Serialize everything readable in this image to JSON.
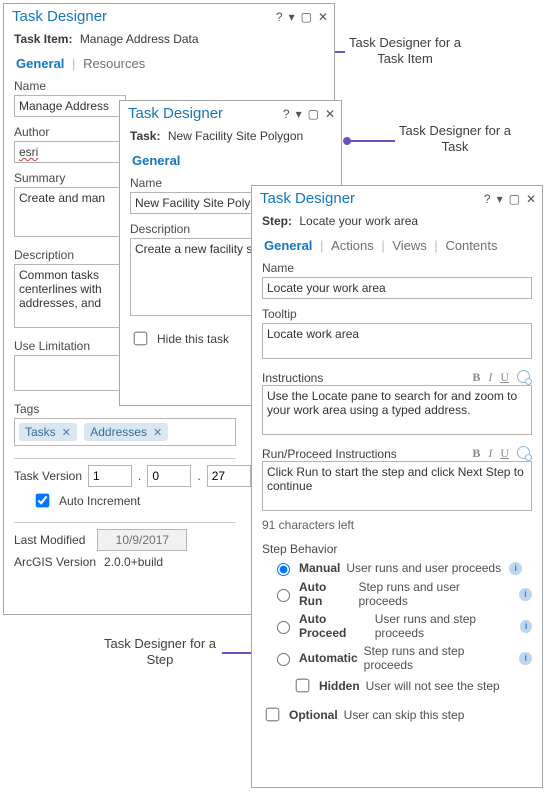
{
  "callouts": {
    "c1a": "Task Designer for a",
    "c1b": "Task Item",
    "c2a": "Task Designer for a",
    "c2b": "Task",
    "c3a": "Task Designer for a",
    "c3b": "Step"
  },
  "pane1": {
    "title": "Task Designer",
    "heading_label": "Task Item:",
    "heading_value": "Manage Address Data",
    "tabs": {
      "general": "General",
      "resources": "Resources"
    },
    "name_label": "Name",
    "name_value": "Manage Address",
    "author_label": "Author",
    "author_value": "esri",
    "summary_label": "Summary",
    "summary_value": "Create and man",
    "description_label": "Description",
    "description_value": "Common tasks\ncenterlines with\naddresses, and",
    "use_limitation_label": "Use Limitation",
    "use_limitation_value": "",
    "tags_label": "Tags",
    "tag1": "Tasks",
    "tag2": "Addresses",
    "task_version_label": "Task Version",
    "ver_major": "1",
    "ver_minor": "0",
    "ver_patch": "27",
    "dot": ".",
    "auto_increment_label": "Auto Increment",
    "last_modified_label": "Last Modified",
    "last_modified_value": "10/9/2017",
    "arcgis_version_label": "ArcGIS Version",
    "arcgis_version_value": "2.0.0+build"
  },
  "pane2": {
    "title": "Task Designer",
    "heading_label": "Task:",
    "heading_value": "New Facility Site Polygon",
    "tabs": {
      "general": "General"
    },
    "name_label": "Name",
    "name_value": "New Facility Site Polyg",
    "description_label": "Description",
    "description_value": "Create a new facility s",
    "hide_label": "Hide this task"
  },
  "pane3": {
    "title": "Task Designer",
    "heading_label": "Step:",
    "heading_value": "Locate your work area",
    "tabs": {
      "general": "General",
      "actions": "Actions",
      "views": "Views",
      "contents": "Contents"
    },
    "sep": "|",
    "name_label": "Name",
    "name_value": "Locate your work area",
    "tooltip_label": "Tooltip",
    "tooltip_value": "Locate work area",
    "instructions_label": "Instructions",
    "instructions_value": "Use the Locate pane to search for and zoom to your work area using a typed address.",
    "run_label": "Run/Proceed Instructions",
    "run_value": "Click Run to start the step and click Next Step to continue",
    "chars_left": "91 characters left",
    "step_behavior_label": "Step Behavior",
    "r1_label": "Manual",
    "r1_desc": "User runs and user proceeds",
    "r2_label": "Auto Run",
    "r2_desc": "Step runs and user proceeds",
    "r3_label": "Auto Proceed",
    "r3_desc": "User runs and step proceeds",
    "r4_label": "Automatic",
    "r4_desc": "Step runs and step proceeds",
    "hidden_label": "Hidden",
    "hidden_desc": "User will not see the step",
    "optional_label": "Optional",
    "optional_desc": "User can skip this step",
    "tb_b": "B",
    "tb_i": "I",
    "tb_u": "U"
  }
}
